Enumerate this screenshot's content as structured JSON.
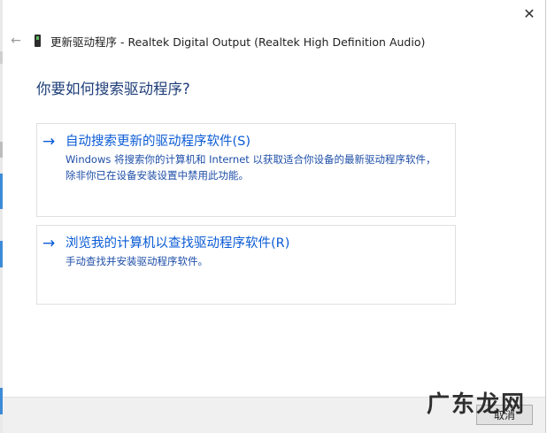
{
  "window": {
    "title": "更新驱动程序 - Realtek Digital Output (Realtek High Definition Audio)",
    "close_glyph": "✕",
    "back_glyph": "←"
  },
  "main": {
    "heading": "你要如何搜索驱动程序?",
    "options": [
      {
        "arrow": "→",
        "title": "自动搜索更新的驱动程序软件(S)",
        "description": "Windows 将搜索你的计算机和 Internet 以获取适合你设备的最新驱动程序软件，除非你已在设备安装设置中禁用此功能。"
      },
      {
        "arrow": "→",
        "title": "浏览我的计算机以查找驱动程序软件(R)",
        "description": "手动查找并安装驱动程序软件。"
      }
    ]
  },
  "footer": {
    "cancel_label": "取消"
  },
  "watermark": {
    "text": "广东龙网"
  },
  "colors": {
    "link_blue": "#0a5bd6",
    "heading_blue": "#1d3d78",
    "footer_bg": "#f0f0f0"
  }
}
